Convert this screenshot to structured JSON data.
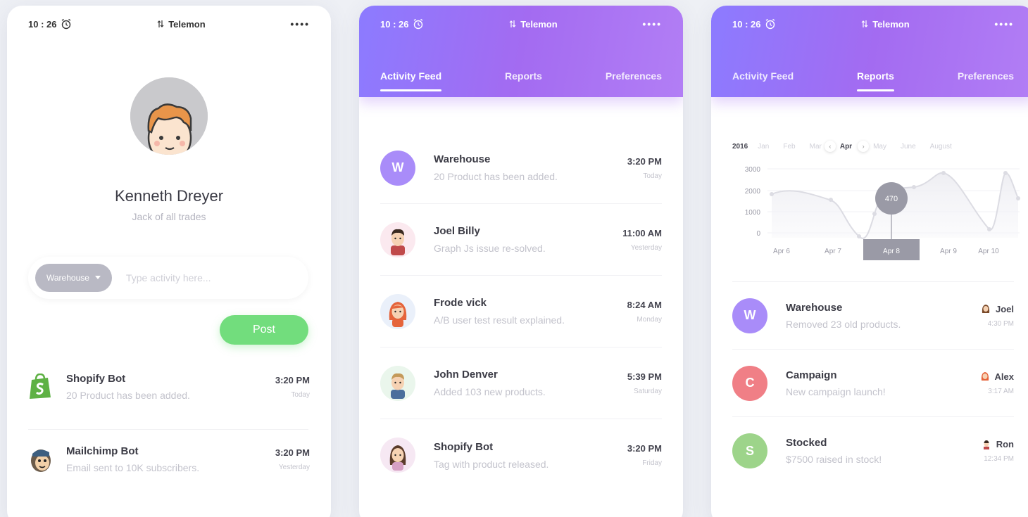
{
  "status": {
    "time": "10 : 26",
    "carrier": "Telemon",
    "dots": "••••"
  },
  "profile": {
    "name": "Kenneth Dreyer",
    "role": "Jack of all trades",
    "pill": "Warehouse",
    "input_placeholder": "Type activity here...",
    "post_label": "Post",
    "feed": [
      {
        "title": "Shopify Bot",
        "sub": "20 Product has been added.",
        "time": "3:20 PM",
        "day": "Today",
        "icon": "shopify-icon"
      },
      {
        "title": "Mailchimp Bot",
        "sub": "Email sent to 10K subscribers.",
        "time": "3:20 PM",
        "day": "Yesterday",
        "icon": "mailchimp-icon"
      }
    ]
  },
  "tabs": [
    "Activity Feed",
    "Reports",
    "Preferences"
  ],
  "activity": [
    {
      "title": "Warehouse",
      "sub": "20 Product has been added.",
      "time": "3:20 PM",
      "day": "Today",
      "avatar_letter": "W"
    },
    {
      "title": "Joel Billy",
      "sub": "Graph Js issue re-solved.",
      "time": "11:00 AM",
      "day": "Yesterday"
    },
    {
      "title": "Frode vick",
      "sub": "A/B user test result explained.",
      "time": "8:24 AM",
      "day": "Monday"
    },
    {
      "title": "John Denver",
      "sub": "Added 103 new products.",
      "time": "5:39 PM",
      "day": "Saturday"
    },
    {
      "title": "Shopify Bot",
      "sub": "Tag with product released.",
      "time": "3:20 PM",
      "day": "Friday"
    }
  ],
  "reports": {
    "year": "2016",
    "months": [
      "Jan",
      "Feb",
      "Mar",
      "Apr",
      "May",
      "June",
      "August"
    ],
    "selected_month": "Apr",
    "list": [
      {
        "title": "Warehouse",
        "sub": "Removed 23 old products.",
        "who": "Joel",
        "time": "4:30 PM",
        "letter": "W"
      },
      {
        "title": "Campaign",
        "sub": "New campaign launch!",
        "who": "Alex",
        "time": "3:17 AM",
        "letter": "C"
      },
      {
        "title": "Stocked",
        "sub": "$7500 raised in stock!",
        "who": "Ron",
        "time": "12:34 PM",
        "letter": "S"
      }
    ]
  },
  "colors": {
    "purple": "#a98cf9",
    "red": "#f07f86",
    "green": "#9dd48a",
    "post_green": "#72dd7d",
    "header_gradient_start": "#8c7bff",
    "header_gradient_end": "#b27ef5"
  },
  "chart_data": {
    "type": "line",
    "x": [
      "Apr 6",
      "Apr 7",
      "Apr 8",
      "Apr 9",
      "Apr 10"
    ],
    "yticks": [
      "3000",
      "2000",
      "1000",
      "0"
    ],
    "ylim": [
      0,
      3000
    ],
    "tooltip": "470",
    "highlighted": "Apr 8"
  }
}
